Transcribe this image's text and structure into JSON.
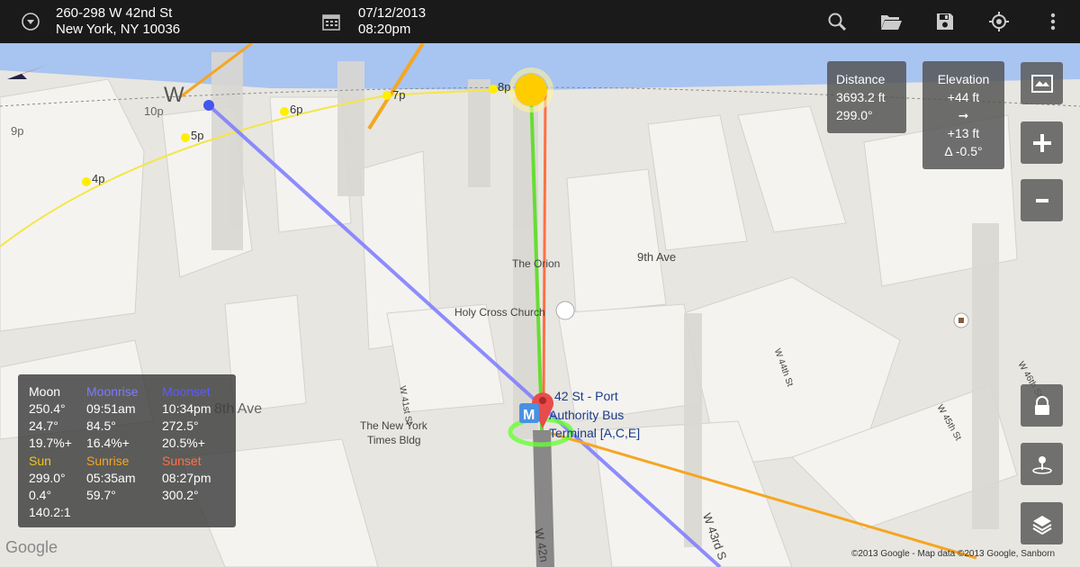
{
  "header": {
    "address_line1": "260-298 W 42nd St",
    "address_line2": "New York, NY 10036",
    "date": "07/12/2013",
    "time": "08:20pm"
  },
  "map": {
    "labels": {
      "the_orion": "The Orion",
      "ninth_ave": "9th Ave",
      "holy_cross": "Holy Cross Church",
      "times_bldg_1": "The New York",
      "times_bldg_2": "Times Bldg",
      "eighth_ave": "8th Ave",
      "w41": "W 41st St",
      "w43": "W 43rd S",
      "w42": "W 42n",
      "w44": "W 44th St",
      "w45": "W 45th St",
      "w46": "W 46th St",
      "station_1": "42 St - Port",
      "station_2": "Authority Bus",
      "station_3": "Terminal [A,C,E]",
      "compass_w": "W"
    },
    "hours": [
      "10p",
      "9p",
      "7p",
      "6p",
      "5p",
      "4p",
      "8p"
    ],
    "attribution": "©2013 Google - Map data ©2013 Google, Sanborn",
    "google_logo": "Google"
  },
  "distance": {
    "label": "Distance",
    "value": "3693.2 ft",
    "bearing": "299.0°"
  },
  "elevation": {
    "label": "Elevation",
    "value": "+44 ft",
    "arrow": "➞",
    "value2": "+13 ft",
    "delta": "Δ -0.5°"
  },
  "info": {
    "moon": {
      "h1": "Moon",
      "h2": "Moonrise",
      "h3": "Moonset",
      "r1": [
        "250.4°",
        "09:51am",
        "10:34pm"
      ],
      "r2": [
        "24.7°",
        "84.5°",
        "272.5°"
      ],
      "r3": [
        "19.7%+",
        "16.4%+",
        "20.5%+"
      ]
    },
    "sun": {
      "h1": "Sun",
      "h2": "Sunrise",
      "h3": "Sunset",
      "r1": [
        "299.0°",
        "05:35am",
        "08:27pm"
      ],
      "r2": [
        "0.4°",
        "59.7°",
        "300.2°"
      ],
      "r3": [
        "140.2:1"
      ]
    }
  },
  "colors": {
    "moon": "#7b7bff",
    "sun": "#f5a623",
    "sunset": "#ff7043",
    "green": "#66dd33",
    "topbar": "#1a1a1a"
  }
}
